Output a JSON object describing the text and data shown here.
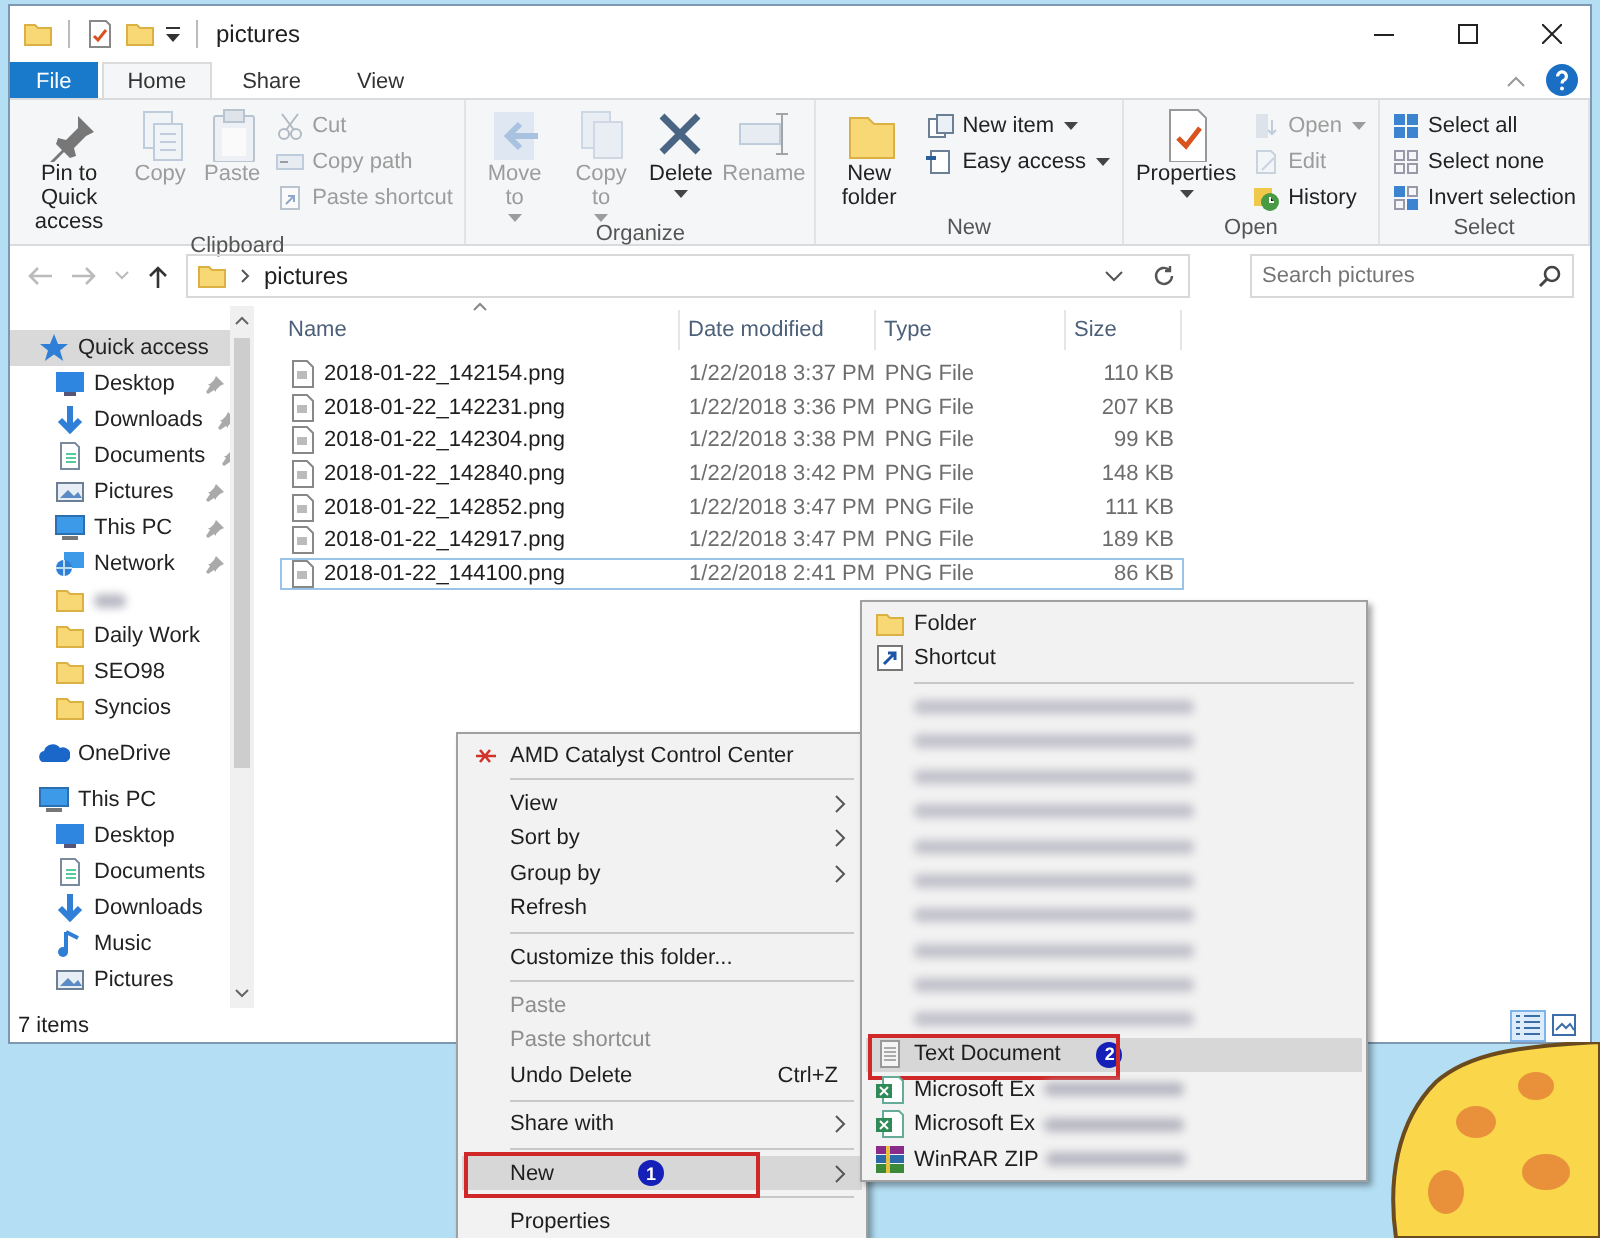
{
  "window": {
    "title": "pictures"
  },
  "ribbon": {
    "tabs": [
      {
        "label": "File",
        "kind": "file",
        "selected": false
      },
      {
        "label": "Home",
        "kind": "tab",
        "selected": true
      },
      {
        "label": "Share",
        "kind": "tab",
        "selected": false
      },
      {
        "label": "View",
        "kind": "tab",
        "selected": false
      }
    ],
    "groups": [
      {
        "label": "Clipboard",
        "buttons": [
          {
            "label": "Pin to Quick access",
            "kind": "large",
            "disabled": false,
            "dropdown": false
          },
          {
            "label": "Copy",
            "kind": "large",
            "disabled": true,
            "dropdown": false
          },
          {
            "label": "Paste",
            "kind": "large",
            "disabled": true,
            "dropdown": false
          },
          {
            "label": "Cut",
            "kind": "small",
            "disabled": true,
            "dropdown": false
          },
          {
            "label": "Copy path",
            "kind": "small",
            "disabled": true,
            "dropdown": false
          },
          {
            "label": "Paste shortcut",
            "kind": "small",
            "disabled": true,
            "dropdown": false
          }
        ]
      },
      {
        "label": "Organize",
        "buttons": [
          {
            "label": "Move to",
            "kind": "large",
            "disabled": true,
            "dropdown": true
          },
          {
            "label": "Copy to",
            "kind": "large",
            "disabled": true,
            "dropdown": true
          },
          {
            "label": "Delete",
            "kind": "large",
            "disabled": false,
            "dropdown": true
          },
          {
            "label": "Rename",
            "kind": "large",
            "disabled": true,
            "dropdown": false
          }
        ]
      },
      {
        "label": "New",
        "buttons": [
          {
            "label": "New folder",
            "kind": "large",
            "disabled": false,
            "dropdown": false
          },
          {
            "label": "New item",
            "kind": "small",
            "disabled": false,
            "dropdown": true
          },
          {
            "label": "Easy access",
            "kind": "small",
            "disabled": false,
            "dropdown": true
          }
        ]
      },
      {
        "label": "Open",
        "buttons": [
          {
            "label": "Properties",
            "kind": "large",
            "disabled": false,
            "dropdown": true
          },
          {
            "label": "Open",
            "kind": "small",
            "disabled": true,
            "dropdown": true
          },
          {
            "label": "Edit",
            "kind": "small",
            "disabled": true,
            "dropdown": false
          },
          {
            "label": "History",
            "kind": "small",
            "disabled": false,
            "dropdown": false
          }
        ]
      },
      {
        "label": "Select",
        "buttons": [
          {
            "label": "Select all",
            "kind": "small",
            "disabled": false,
            "dropdown": false
          },
          {
            "label": "Select none",
            "kind": "small",
            "disabled": false,
            "dropdown": false
          },
          {
            "label": "Invert selection",
            "kind": "small",
            "disabled": false,
            "dropdown": false
          }
        ]
      }
    ]
  },
  "address_bar": {
    "path": [
      "pictures"
    ],
    "search_placeholder": "Search pictures"
  },
  "navigation_pane": [
    {
      "label": "Quick access",
      "kind": "quick",
      "selected": true,
      "pinned": false,
      "children": [
        {
          "label": "Desktop",
          "kind": "desktop",
          "selected": false,
          "pinned": true
        },
        {
          "label": "Downloads",
          "kind": "downloads",
          "selected": false,
          "pinned": true
        },
        {
          "label": "Documents",
          "kind": "documents",
          "selected": false,
          "pinned": true
        },
        {
          "label": "Pictures",
          "kind": "pictures",
          "selected": false,
          "pinned": true
        },
        {
          "label": "This PC",
          "kind": "pc",
          "selected": false,
          "pinned": true
        },
        {
          "label": "Network",
          "kind": "network",
          "selected": false,
          "pinned": true
        },
        {
          "kind": "blurred",
          "selected": false,
          "pinned": false
        },
        {
          "label": "Daily Work",
          "kind": "folder",
          "selected": false,
          "pinned": false
        },
        {
          "label": "SEO98",
          "kind": "folder",
          "selected": false,
          "pinned": false
        },
        {
          "label": "Syncios",
          "kind": "folder",
          "selected": false,
          "pinned": false
        }
      ]
    },
    {
      "label": "OneDrive",
      "kind": "onedrive",
      "selected": false,
      "pinned": false
    },
    {
      "label": "This PC",
      "kind": "pc",
      "selected": false,
      "pinned": false,
      "children": [
        {
          "label": "Desktop",
          "kind": "desktop",
          "selected": false,
          "pinned": false
        },
        {
          "label": "Documents",
          "kind": "documents",
          "selected": false,
          "pinned": false
        },
        {
          "label": "Downloads",
          "kind": "downloads",
          "selected": false,
          "pinned": false
        },
        {
          "label": "Music",
          "kind": "music",
          "selected": false,
          "pinned": false
        },
        {
          "label": "Pictures",
          "kind": "pictures",
          "selected": false,
          "pinned": false
        }
      ]
    }
  ],
  "file_list": {
    "columns": [
      {
        "label": "Name",
        "sorted": true
      },
      {
        "label": "Date modified",
        "sorted": false
      },
      {
        "label": "Type",
        "sorted": false
      },
      {
        "label": "Size",
        "sorted": false
      }
    ],
    "rows": [
      {
        "name": "2018-01-22_142154.png",
        "date_modified": "1/22/2018 3:37 PM",
        "type": "PNG File",
        "size": "110 KB",
        "focused": false
      },
      {
        "name": "2018-01-22_142231.png",
        "date_modified": "1/22/2018 3:36 PM",
        "type": "PNG File",
        "size": "207 KB",
        "focused": false
      },
      {
        "name": "2018-01-22_142304.png",
        "date_modified": "1/22/2018 3:38 PM",
        "type": "PNG File",
        "size": "99 KB",
        "focused": false
      },
      {
        "name": "2018-01-22_142840.png",
        "date_modified": "1/22/2018 3:42 PM",
        "type": "PNG File",
        "size": "148 KB",
        "focused": false
      },
      {
        "name": "2018-01-22_142852.png",
        "date_modified": "1/22/2018 3:47 PM",
        "type": "PNG File",
        "size": "111 KB",
        "focused": false
      },
      {
        "name": "2018-01-22_142917.png",
        "date_modified": "1/22/2018 3:47 PM",
        "type": "PNG File",
        "size": "189 KB",
        "focused": false
      },
      {
        "name": "2018-01-22_144100.png",
        "date_modified": "1/22/2018 2:41 PM",
        "type": "PNG File",
        "size": "86 KB",
        "focused": true
      }
    ]
  },
  "status_bar": {
    "item_count": "7 items",
    "view_buttons": [
      {
        "kind": "details",
        "selected": true
      },
      {
        "kind": "icons",
        "selected": false
      }
    ]
  },
  "context_menu": {
    "items": [
      {
        "kind": "app",
        "label": "AMD Catalyst Control Center",
        "disabled": false,
        "submenu": false,
        "selected": false
      },
      {
        "kind": "separator"
      },
      {
        "kind": "item",
        "label": "View",
        "disabled": false,
        "submenu": true,
        "selected": false
      },
      {
        "kind": "item",
        "label": "Sort by",
        "disabled": false,
        "submenu": true,
        "selected": false
      },
      {
        "kind": "item",
        "label": "Group by",
        "disabled": false,
        "submenu": true,
        "selected": false
      },
      {
        "kind": "item",
        "label": "Refresh",
        "disabled": false,
        "submenu": false,
        "selected": false
      },
      {
        "kind": "separator"
      },
      {
        "kind": "item",
        "label": "Customize this folder...",
        "disabled": false,
        "submenu": false,
        "selected": false
      },
      {
        "kind": "separator"
      },
      {
        "kind": "item",
        "label": "Paste",
        "disabled": true,
        "submenu": false,
        "selected": false
      },
      {
        "kind": "item",
        "label": "Paste shortcut",
        "disabled": true,
        "submenu": false,
        "selected": false
      },
      {
        "kind": "item",
        "label": "Undo Delete",
        "shortcut": "Ctrl+Z",
        "disabled": false,
        "submenu": false,
        "selected": false
      },
      {
        "kind": "separator"
      },
      {
        "kind": "item",
        "label": "Share with",
        "disabled": false,
        "submenu": true,
        "selected": false
      },
      {
        "kind": "separator"
      },
      {
        "kind": "item",
        "label": "New",
        "disabled": false,
        "submenu": true,
        "selected": true,
        "callout": "1"
      },
      {
        "kind": "separator"
      },
      {
        "kind": "item",
        "label": "Properties",
        "disabled": false,
        "submenu": false,
        "selected": false
      }
    ]
  },
  "new_submenu": {
    "items": [
      {
        "kind": "folder",
        "label": "Folder",
        "selected": false,
        "blurred_suffix": false
      },
      {
        "kind": "shortcut",
        "label": "Shortcut",
        "selected": false,
        "blurred_suffix": false
      },
      {
        "kind": "separator"
      },
      {
        "kind": "blurred"
      },
      {
        "kind": "blurred"
      },
      {
        "kind": "blurred"
      },
      {
        "kind": "blurred"
      },
      {
        "kind": "blurred"
      },
      {
        "kind": "blurred"
      },
      {
        "kind": "blurred"
      },
      {
        "kind": "blurred"
      },
      {
        "kind": "blurred"
      },
      {
        "kind": "blurred"
      },
      {
        "kind": "text",
        "label": "Text Document",
        "selected": true,
        "callout": "2",
        "blurred_suffix": false
      },
      {
        "kind": "excel",
        "label": "Microsoft Ex",
        "selected": false,
        "blurred_suffix": true
      },
      {
        "kind": "excel",
        "label": "Microsoft Ex",
        "selected": false,
        "blurred_suffix": true
      },
      {
        "kind": "archive",
        "label": "WinRAR ZIP",
        "selected": false,
        "blurred_suffix": true
      }
    ]
  }
}
